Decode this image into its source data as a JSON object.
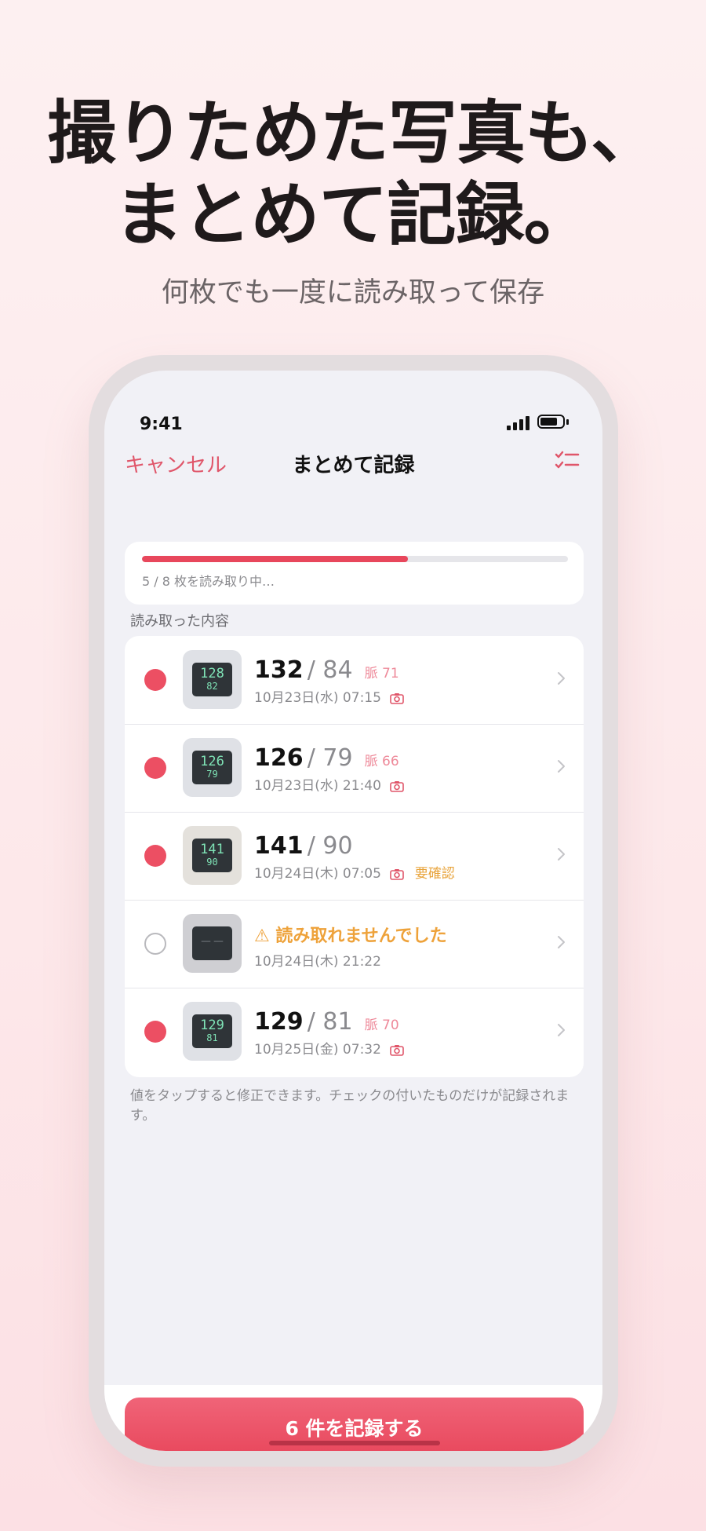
{
  "headline": {
    "line1": "撮りためた写真も、",
    "line2": "まとめて記録。",
    "sub": "何枚でも一度に読み取って保存"
  },
  "status_bar": {
    "time": "9:41"
  },
  "nav": {
    "cancel": "キャンセル",
    "title": "まとめて記録",
    "right_icon": "checklist-icon"
  },
  "progress": {
    "fraction": 0.625,
    "text": "5 / 8 枚を読み取り中…"
  },
  "section_label": "読み取った内容",
  "rows": [
    {
      "checked": true,
      "lcd_sys": "128",
      "lcd_dia": "82",
      "sys": "132",
      "dia": "/ 84",
      "pulse": "脈 71",
      "meta": "10月23日(水) 07:15"
    },
    {
      "checked": true,
      "lcd_sys": "126",
      "lcd_dia": "79",
      "sys": "126",
      "dia": "/ 79",
      "pulse": "脈 66",
      "meta": "10月23日(水) 21:40"
    },
    {
      "checked": true,
      "lcd_sys": "141",
      "lcd_dia": "90",
      "sys": "141",
      "dia": "/ 90",
      "meta": "10月24日(木) 07:05",
      "badge": "要確認"
    },
    {
      "checked": false,
      "lcd_blank": "－－",
      "warn": "⚠ 読み取れませんでした",
      "meta": "10月24日(木) 21:22"
    },
    {
      "checked": true,
      "lcd_sys": "129",
      "lcd_dia": "81",
      "sys": "129",
      "dia": "/ 81",
      "pulse": "脈 70",
      "meta": "10月25日(金) 07:32"
    }
  ],
  "hint": "値をタップすると修正できます。チェックの付いたものだけが記録されます。",
  "record_button": "6 件を記録する",
  "colors": {
    "accent": "#e8475c",
    "warning": "#eea23a",
    "pulse": "#ee8a9a"
  }
}
